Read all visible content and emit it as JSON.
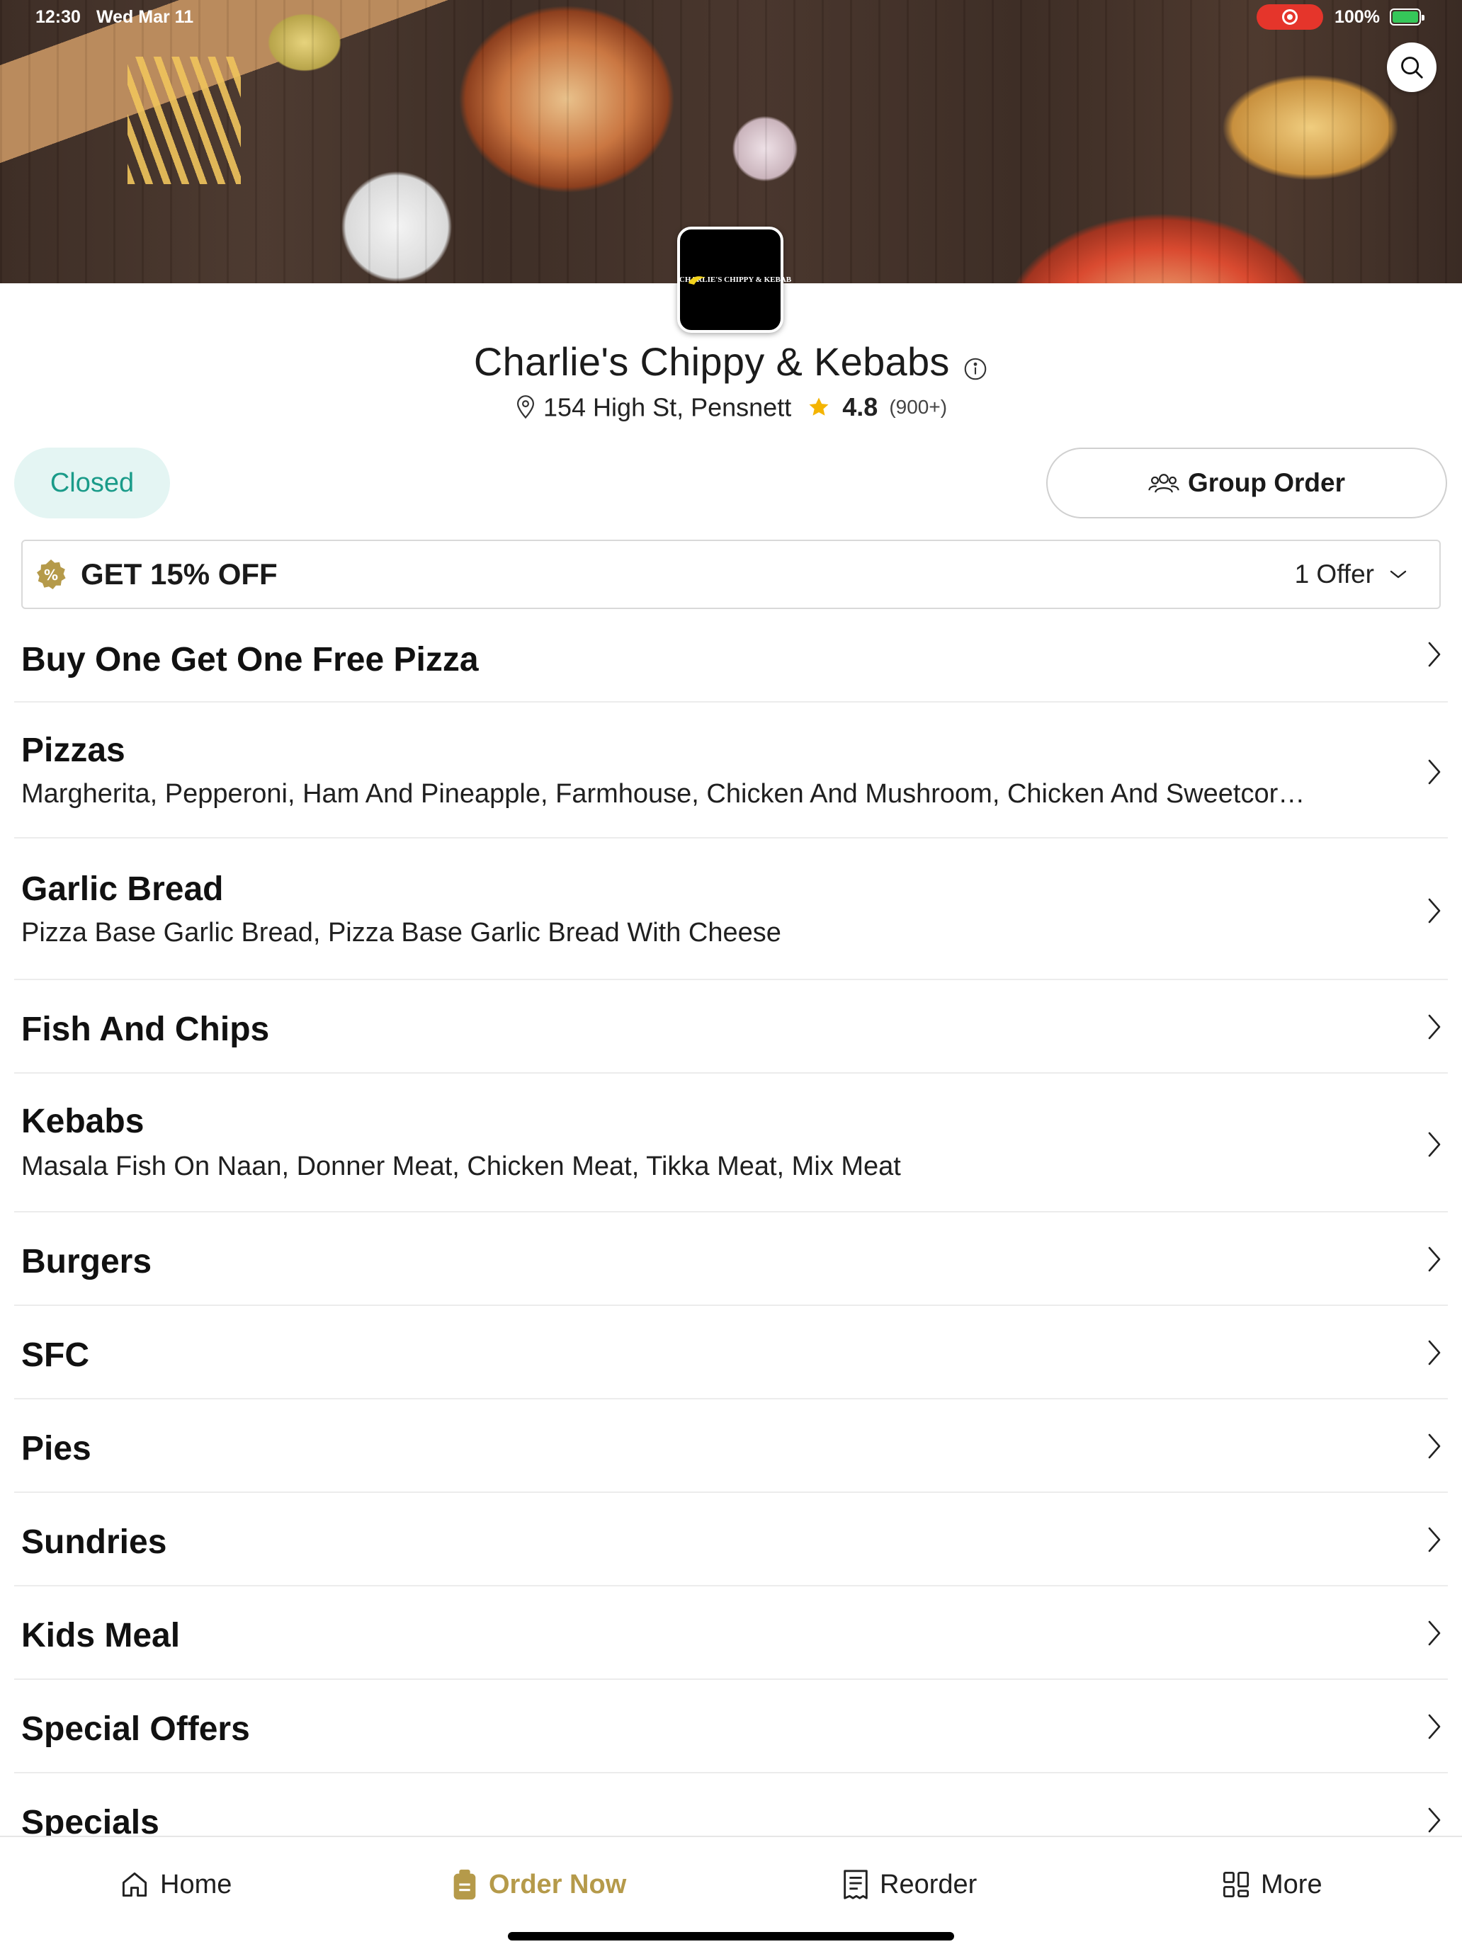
{
  "status_bar": {
    "time": "12:30",
    "date": "Wed Mar 11",
    "battery": "100%"
  },
  "restaurant": {
    "name": "Charlie's Chippy & Kebabs",
    "logo_text": "CHARLIE'S CHIPPY & KEBAB",
    "address": "154 High St, Pensnett",
    "rating": "4.8",
    "rating_count": "(900+)"
  },
  "status_pill": "Closed",
  "group_order_label": "Group Order",
  "offer": {
    "title": "GET 15% OFF",
    "count_label": "1 Offer",
    "badge_symbol": "%"
  },
  "menu": [
    {
      "title": "Buy One Get One Free Pizza",
      "desc": ""
    },
    {
      "title": "Pizzas",
      "desc": "Margherita, Pepperoni, Ham And Pineapple, Farmhouse, Chicken And Mushroom, Chicken And Sweetcor…"
    },
    {
      "title": "Garlic Bread",
      "desc": "Pizza Base Garlic Bread, Pizza Base Garlic Bread With Cheese"
    },
    {
      "title": "Fish And Chips",
      "desc": ""
    },
    {
      "title": "Kebabs",
      "desc": "Masala Fish On Naan, Donner Meat, Chicken Meat, Tikka Meat, Mix Meat"
    },
    {
      "title": "Burgers",
      "desc": ""
    },
    {
      "title": "SFC",
      "desc": ""
    },
    {
      "title": "Pies",
      "desc": ""
    },
    {
      "title": "Sundries",
      "desc": ""
    },
    {
      "title": "Kids Meal",
      "desc": ""
    },
    {
      "title": "Special Offers",
      "desc": ""
    },
    {
      "title": "Specials",
      "desc": ""
    }
  ],
  "nav": {
    "home": "Home",
    "order_now": "Order Now",
    "reorder": "Reorder",
    "more": "More"
  },
  "colors": {
    "accent_gold": "#b59a4a",
    "closed_teal": "#1a9b89",
    "closed_bg": "#e4f5f3",
    "star": "#f4b400",
    "record_red": "#e5352b"
  }
}
